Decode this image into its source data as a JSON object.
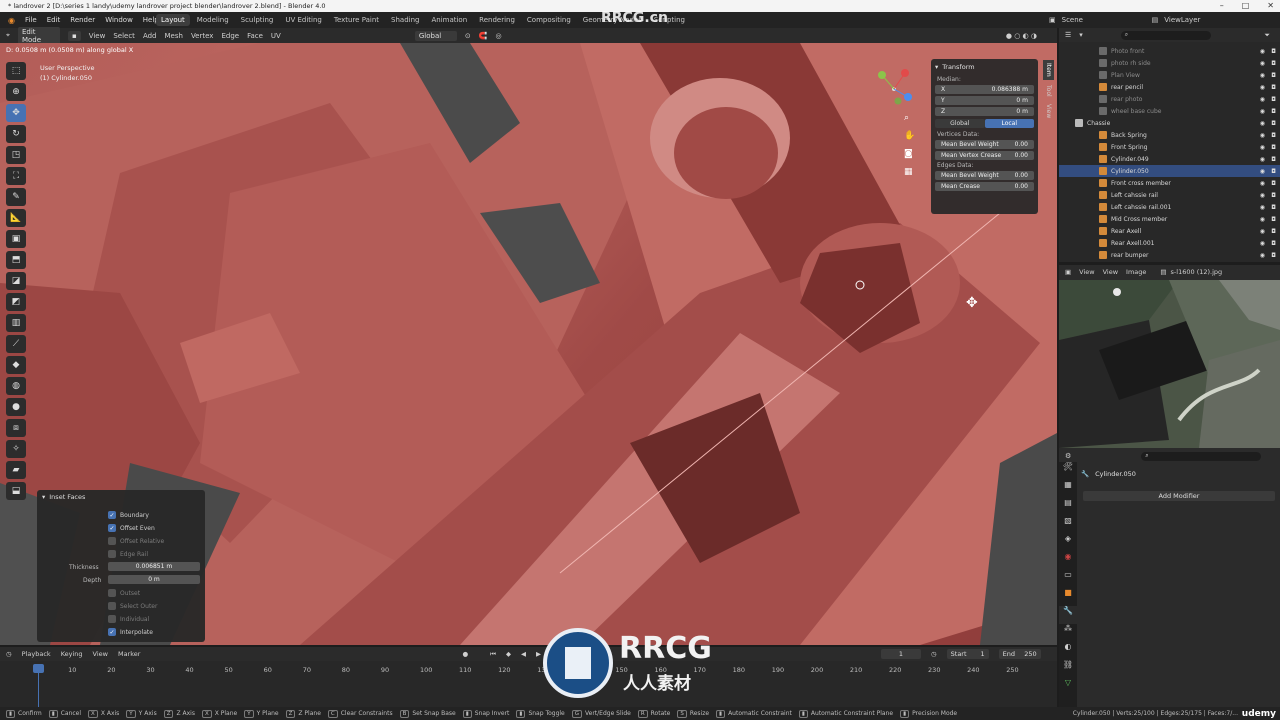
{
  "window": {
    "title": "* landrover 2 [D:\\series 1 landy\\udemy landrover project blender\\landrover 2.blend] - Blender 4.0"
  },
  "menu": [
    "File",
    "Edit",
    "Render",
    "Window",
    "Help"
  ],
  "workspaces": [
    "Layout",
    "Modeling",
    "Sculpting",
    "UV Editing",
    "Texture Paint",
    "Shading",
    "Animation",
    "Rendering",
    "Compositing",
    "Geometry Nodes",
    "Scripting"
  ],
  "active_workspace": "Layout",
  "scene": "Scene",
  "view_layer": "ViewLayer",
  "viewport_header": {
    "mode": "Edit Mode",
    "menus": [
      "View",
      "Select",
      "Add",
      "Mesh",
      "Vertex",
      "Edge",
      "Face",
      "UV"
    ],
    "orientation": "Global"
  },
  "viewport": {
    "operator_info": "D: 0.0508 m (0.0508 m) along global X",
    "perspective": "User Perspective",
    "object_label": "(1) Cylinder.050"
  },
  "npanel": {
    "tabs": [
      "Item",
      "Tool",
      "View"
    ],
    "title": "Transform",
    "median_label": "Median:",
    "x_label": "X",
    "x_value": "0.086388 m",
    "y_label": "Y",
    "y_value": "0 m",
    "z_label": "Z",
    "z_value": "0 m",
    "global_btn": "Global",
    "local_btn": "Local",
    "vertices_data": "Vertices Data:",
    "mean_bevel_weight_label": "Mean Bevel Weight",
    "mean_bevel_weight_v": "0.00",
    "mean_vertex_crease_label": "Mean Vertex Crease",
    "mean_vertex_crease": "0.00",
    "edges_data": "Edges Data:",
    "edge_bevel_weight_label": "Mean Bevel Weight",
    "edge_bevel_weight": "0.00",
    "mean_crease_label": "Mean Crease",
    "mean_crease": "0.00"
  },
  "inset": {
    "title": "Inset Faces",
    "boundary": "Boundary",
    "offset_even": "Offset Even",
    "offset_relative": "Offset Relative",
    "edge_rail": "Edge Rail",
    "thickness_label": "Thickness",
    "thickness": "0.006851 m",
    "depth_label": "Depth",
    "depth": "0 m",
    "outset": "Outset",
    "select_outer": "Select Outer",
    "individual": "Individual",
    "interpolate": "Interpolate"
  },
  "outliner": {
    "items": [
      {
        "name": "Photo front",
        "dim": true
      },
      {
        "name": "photo rh side",
        "dim": true
      },
      {
        "name": "Plan View",
        "dim": true
      },
      {
        "name": "rear pencil",
        "dim": false
      },
      {
        "name": "rear photo",
        "dim": true
      },
      {
        "name": "wheel base cube",
        "dim": true
      },
      {
        "name": "Chassie",
        "dim": false
      },
      {
        "name": "Back Spring",
        "dim": false
      },
      {
        "name": "Front Spring",
        "dim": false
      },
      {
        "name": "Cylinder.049",
        "dim": false
      },
      {
        "name": "Cylinder.050",
        "dim": false
      },
      {
        "name": "Front cross member",
        "dim": false
      },
      {
        "name": "Left cahssie rail",
        "dim": false
      },
      {
        "name": "Left cahssie rail.001",
        "dim": false
      },
      {
        "name": "Mid Cross member",
        "dim": false
      },
      {
        "name": "Rear Axell",
        "dim": false
      },
      {
        "name": "Rear Axell.001",
        "dim": false
      },
      {
        "name": "rear bumper",
        "dim": false
      }
    ]
  },
  "image_editor": {
    "menus": [
      "View",
      "View",
      "Image"
    ],
    "image_name": "s-l1600 (12).jpg"
  },
  "properties": {
    "object": "Cylinder.050",
    "add_modifier": "Add Modifier"
  },
  "timeline": {
    "menus": [
      "Playback",
      "Keying",
      "View",
      "Marker"
    ],
    "current_frame": "1",
    "start_label": "Start",
    "start": "1",
    "end_label": "End",
    "end": "250",
    "ticks": [
      "1",
      "10",
      "20",
      "30",
      "40",
      "50",
      "60",
      "70",
      "80",
      "90",
      "100",
      "110",
      "120",
      "130",
      "140",
      "150",
      "160",
      "170",
      "180",
      "190",
      "200",
      "210",
      "220",
      "230",
      "240",
      "250"
    ]
  },
  "statusbar": {
    "items": [
      {
        "key": "",
        "label": "Confirm"
      },
      {
        "key": "",
        "label": "Cancel"
      },
      {
        "key": "X",
        "label": "X Axis"
      },
      {
        "key": "Y",
        "label": "Y Axis"
      },
      {
        "key": "Z",
        "label": "Z Axis"
      },
      {
        "key": "X",
        "label": "X Plane"
      },
      {
        "key": "Y",
        "label": "Y Plane"
      },
      {
        "key": "Z",
        "label": "Z Plane"
      },
      {
        "key": "C",
        "label": "Clear Constraints"
      },
      {
        "key": "B",
        "label": "Set Snap Base"
      },
      {
        "key": "",
        "label": "Snap Invert"
      },
      {
        "key": "",
        "label": "Snap Toggle"
      },
      {
        "key": "G",
        "label": "Vert/Edge Slide"
      },
      {
        "key": "R",
        "label": "Rotate"
      },
      {
        "key": "S",
        "label": "Resize"
      },
      {
        "key": "",
        "label": "Automatic Constraint"
      },
      {
        "key": "",
        "label": "Automatic Constraint Plane"
      },
      {
        "key": "",
        "label": "Precision Mode"
      }
    ],
    "stats": "Cylinder.050 | Verts:25/100 | Edges:25/175 | Faces:7/...",
    "brand": "udemy"
  },
  "watermark": {
    "logo_text": "RRCG",
    "logo_sub": "人人素材",
    "header_text": "RRCG.cn"
  },
  "colors": {
    "accent": "#4772b3",
    "mesh": "#b5605a",
    "selection": "#334d80"
  }
}
